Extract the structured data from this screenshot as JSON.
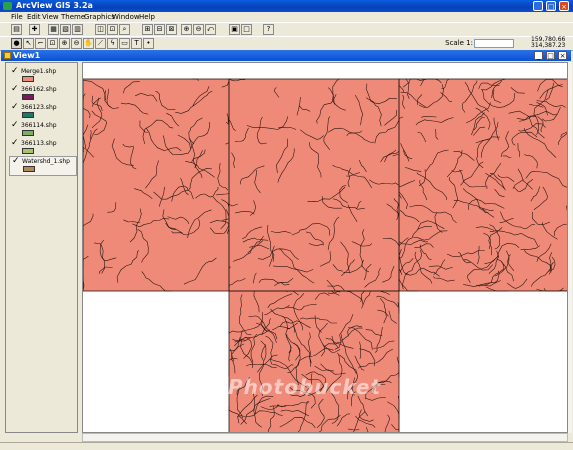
{
  "app": {
    "title": "ArcView GIS 3.2a",
    "window_buttons": {
      "minimize": "_",
      "maximize": "□",
      "close": "×"
    }
  },
  "menu": [
    "File",
    "Edit",
    "View",
    "Theme",
    "Graphics",
    "Window",
    "Help"
  ],
  "toolbar": {
    "scale_label": "Scale 1:",
    "scale_value": "",
    "coord_x": "159,780.66",
    "coord_y": "314,387.23",
    "text_tool": "T"
  },
  "view": {
    "title": "View1",
    "window_buttons": {
      "minimize": "_",
      "maximize": "□",
      "close": "×"
    }
  },
  "toc": {
    "layers": [
      {
        "name": "Merge1.shp",
        "visible": true,
        "color": "#f08a78"
      },
      {
        "name": "366162.shp",
        "visible": true,
        "color": "#7a1a5a"
      },
      {
        "name": "366123.shp",
        "visible": true,
        "color": "#1a7a6a"
      },
      {
        "name": "366114.shp",
        "visible": true,
        "color": "#7aae62"
      },
      {
        "name": "366113.shp",
        "visible": true,
        "color": "#a8c272"
      },
      {
        "name": "Watershd_1.shp",
        "visible": true,
        "color": "#b08a5a"
      }
    ]
  },
  "map": {
    "fill_color": "#f08a78",
    "line_color": "#2a1510",
    "background": "#ffffff",
    "watermark": "Photobucket"
  }
}
